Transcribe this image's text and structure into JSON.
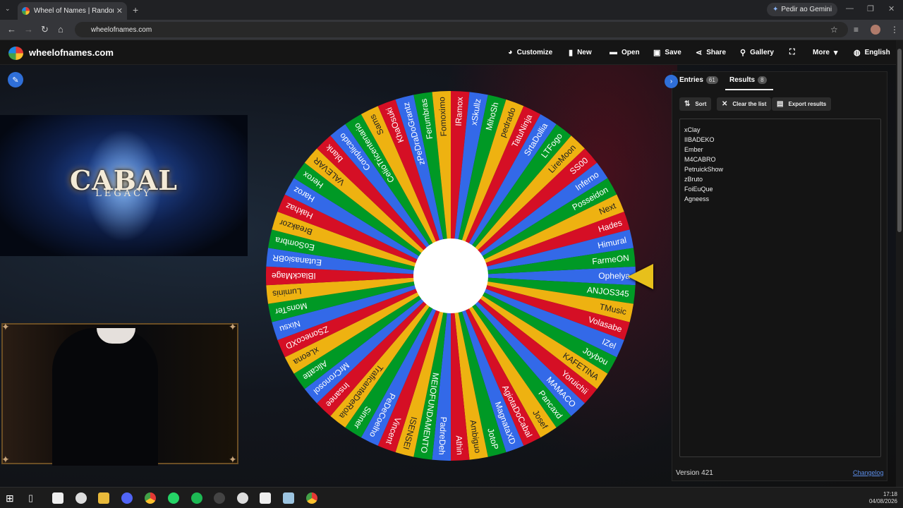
{
  "browser": {
    "tab_title": "Wheel of Names | Random nam",
    "url": "wheelofnames.com",
    "gemini_label": "Pedir ao Gemini"
  },
  "site": {
    "name": "wheelofnames.com",
    "menu": [
      {
        "icon": "palette-icon",
        "label": "Customize"
      },
      {
        "icon": "file-icon",
        "label": "New"
      },
      {
        "icon": "folder-icon",
        "label": "Open"
      },
      {
        "icon": "save-icon",
        "label": "Save"
      },
      {
        "icon": "share-icon",
        "label": "Share"
      },
      {
        "icon": "search-icon",
        "label": "Gallery"
      },
      {
        "icon": "fullscreen-icon",
        "label": ""
      },
      {
        "icon": "chevron-down-icon",
        "label": "More"
      },
      {
        "icon": "globe-icon",
        "label": "English"
      }
    ]
  },
  "banner": {
    "title": "CABAL",
    "subtitle": "LEGACY"
  },
  "wheel": {
    "colors": [
      "#3369e8",
      "#009925",
      "#eeb211",
      "#d50f25"
    ],
    "entries": [
      "Ophelya",
      "ANJOS345",
      "TMusic",
      "Volasabe",
      "IZel",
      "Joybou",
      "KAFETINA",
      "Yoruichii",
      "MAMACO",
      "Pancaxd",
      "Josef",
      "AgiotaDoCabal",
      "MagnataXD",
      "JotoP",
      "Ambiguo",
      "Athin",
      "PadreDeh",
      "MEIOFUNDAMENTO",
      "ISENSEI",
      "Vincent",
      "PeDeCoelho",
      "Sinner",
      "TraficanteDeRola",
      "Insanee",
      "MrCronosol",
      "Alicatte",
      "xLeona",
      "ZSonecoXD",
      "Nixsu",
      "MonsTer",
      "Luminis",
      "IBlackMage",
      "EutanasioBR",
      "EoSombra",
      "Breakzor",
      "Hakhaz",
      "Haroz",
      "Herox",
      "VALEVAR",
      "blank",
      "Complicado",
      "CelioTricentenario",
      "Sams",
      "KhaOsuki",
      "zPeDraDoGrantz",
      "Ferumbras",
      "Fomoximo",
      "IRamox",
      "xSkullz",
      "MihoSh",
      "pedrado",
      "TatuNinja",
      "SrtaDollia",
      "LTFogo",
      "LireMoon",
      "SS00",
      "Inferno",
      "Posseidon",
      "Next",
      "Hades",
      "Himural",
      "FarmeON"
    ]
  },
  "panel": {
    "entries_tab": "Entries",
    "entries_count": "61",
    "results_tab": "Results",
    "results_count": "8",
    "sort_label": "Sort",
    "clear_label": "Clear the list",
    "export_label": "Export results",
    "results": [
      "xClay",
      "IIBADEKO",
      "Ember",
      "M4CABRO",
      "PetruickShow",
      "zBruto",
      "FoiEuQue",
      "Agneess"
    ],
    "version": "Version 421",
    "changelog": "Changelog"
  },
  "taskbar": {
    "time": "17:18",
    "date": "04/08/2026"
  }
}
